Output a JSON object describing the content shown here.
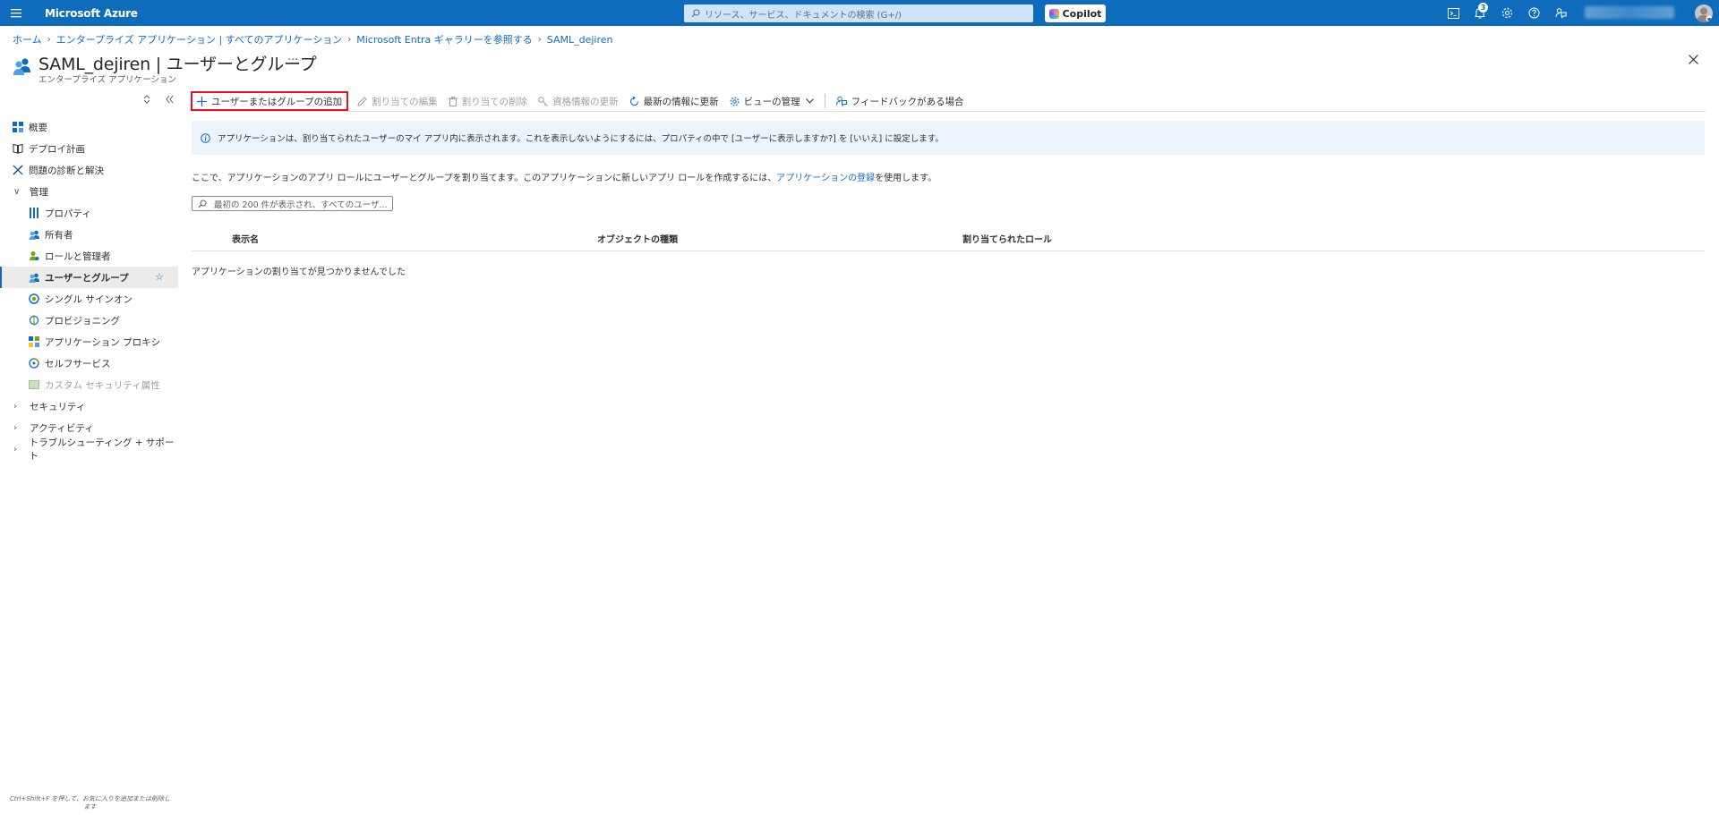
{
  "topbar": {
    "brand": "Microsoft Azure",
    "search_placeholder": "リソース、サービス、ドキュメントの検索 (G+/)",
    "copilot_label": "Copilot",
    "notification_count": "3"
  },
  "breadcrumb": [
    "ホーム",
    "エンタープライズ アプリケーション | すべてのアプリケーション",
    "Microsoft Entra ギャラリーを参照する",
    "SAML_dejiren"
  ],
  "header": {
    "title": "SAML_dejiren | ユーザーとグループ",
    "subtitle": "エンタープライズ アプリケーション",
    "more": "···"
  },
  "sidebar": {
    "items": [
      {
        "label": "概要"
      },
      {
        "label": "デプロイ計画"
      },
      {
        "label": "問題の診断と解決"
      },
      {
        "label": "管理"
      },
      {
        "label": "プロパティ"
      },
      {
        "label": "所有者"
      },
      {
        "label": "ロールと管理者"
      },
      {
        "label": "ユーザーとグループ"
      },
      {
        "label": "シングル サインオン"
      },
      {
        "label": "プロビジョニング"
      },
      {
        "label": "アプリケーション プロキシ"
      },
      {
        "label": "セルフサービス"
      },
      {
        "label": "カスタム セキュリティ属性"
      },
      {
        "label": "セキュリティ"
      },
      {
        "label": "アクティビティ"
      },
      {
        "label": "トラブルシューティング + サポート"
      }
    ],
    "footer_hint": "Ctrl+Shift+F を押して、お気に入りを追加または削除します"
  },
  "commands": {
    "add": "ユーザーまたはグループの追加",
    "edit": "割り当ての編集",
    "remove": "割り当ての削除",
    "update_credentials": "資格情報の更新",
    "refresh": "最新の情報に更新",
    "manage_view": "ビューの管理",
    "feedback": "フィードバックがある場合"
  },
  "info_banner": "アプリケーションは、割り当てられたユーザーのマイ アプリ内に表示されます。これを表示しないようにするには、プロパティの中で [ユーザーに表示しますか?] を [いいえ] に設定します。",
  "description": {
    "before": "ここで、アプリケーションのアプリ ロールにユーザーとグループを割り当てます。このアプリケーションに新しいアプリ ロールを作成するには、",
    "link": "アプリケーションの登録",
    "after": "を使用します。"
  },
  "filter_placeholder": "最初の 200 件が表示され、すべてのユーザ...",
  "table": {
    "columns": [
      "表示名",
      "オブジェクトの種類",
      "割り当てられたロール"
    ],
    "empty_message": "アプリケーションの割り当てが見つかりませんでした"
  },
  "colors": {
    "accent": "#0f6cbd",
    "highlight_border": "#e81123"
  }
}
